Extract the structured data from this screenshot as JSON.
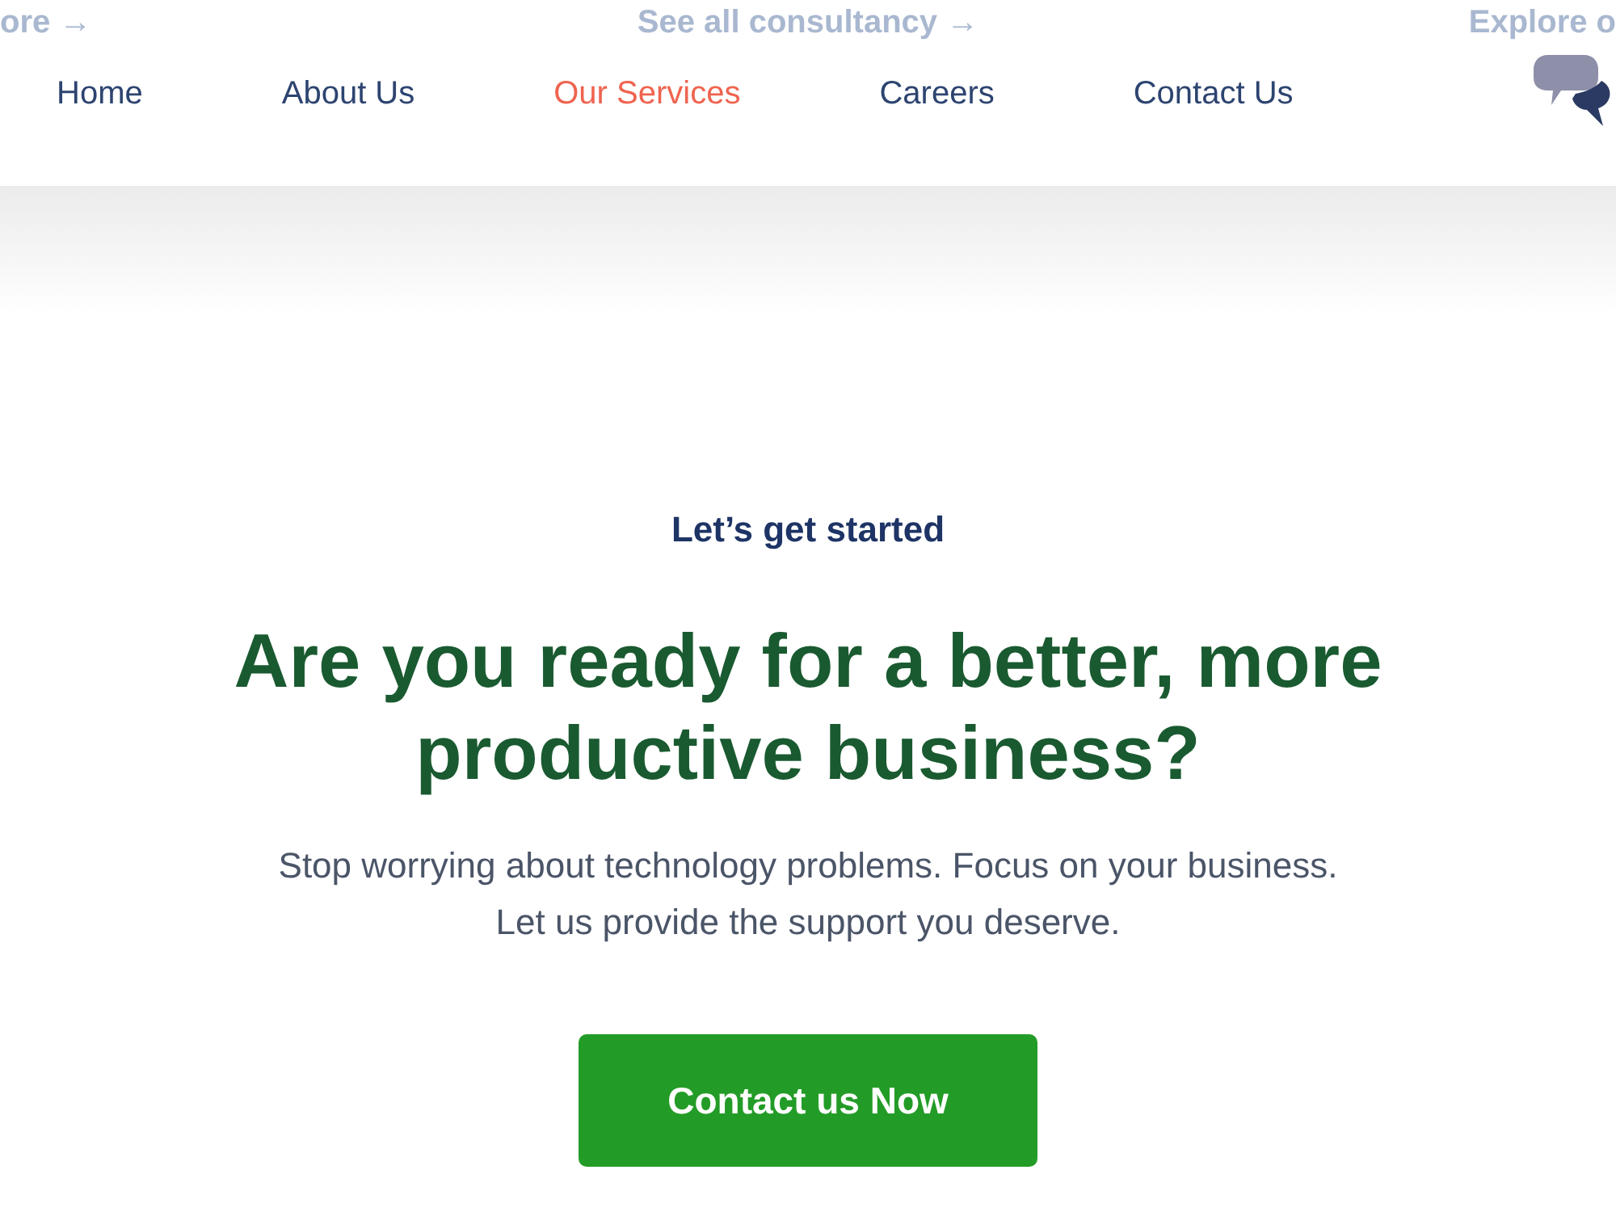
{
  "top_links": [
    {
      "label": "ore →"
    },
    {
      "label": "See all consultancy →"
    },
    {
      "label": "Explore o"
    }
  ],
  "nav": {
    "items": [
      {
        "label": "Home",
        "selected": false
      },
      {
        "label": "About Us",
        "selected": false
      },
      {
        "label": "Our Services",
        "selected": true
      },
      {
        "label": "Careers",
        "selected": false
      },
      {
        "label": "Contact Us",
        "selected": false
      }
    ]
  },
  "hero": {
    "eyebrow": "Let’s get started",
    "heading": "Are you ready for a better, more productive business?",
    "text": "Stop worrying about technology problems. Focus on your business. Let us provide the support you deserve.",
    "button": "Contact us Now"
  }
}
